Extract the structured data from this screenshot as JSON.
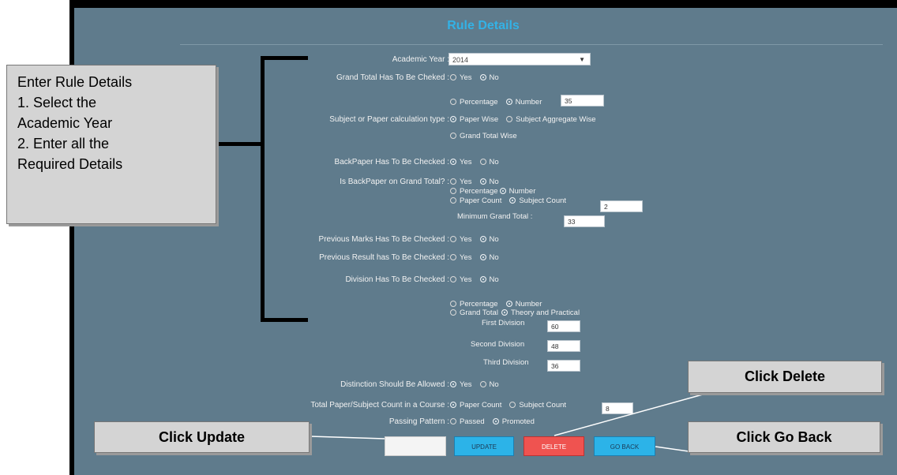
{
  "page": {
    "title": "Rule Details"
  },
  "form": {
    "academic_year": {
      "label": "Academic Year :",
      "value": "2014"
    },
    "grand_total": {
      "label": "Grand Total Has To Be Cheked :",
      "options": [
        "Yes",
        "No"
      ],
      "selected": "No"
    },
    "calc_basis": {
      "options": [
        "Percentage",
        "Number"
      ],
      "selected": "Number",
      "value": "35"
    },
    "calc_type": {
      "label": "Subject or Paper calculation type :",
      "options": [
        "Paper Wise",
        "Subject Aggregate Wise",
        "Grand Total Wise"
      ],
      "selected": "Paper Wise"
    },
    "backpaper": {
      "label": "BackPaper Has To Be Checked :",
      "options": [
        "Yes",
        "No"
      ],
      "selected": "Yes"
    },
    "backpaper_grand": {
      "label": "Is BackPaper on Grand Total? :",
      "options": [
        "Yes",
        "No"
      ],
      "selected": "No",
      "basis_options": [
        "Percentage",
        "Number"
      ],
      "basis_selected": "Number",
      "count_options": [
        "Paper Count",
        "Subject Count"
      ],
      "count_selected": "Subject Count",
      "count_value": "2",
      "min_label": "Minimum Grand Total :",
      "min_value": "33"
    },
    "prev_marks": {
      "label": "Previous Marks Has To Be Checked :",
      "options": [
        "Yes",
        "No"
      ],
      "selected": "No"
    },
    "prev_result": {
      "label": "Previous Result has To Be Checked :",
      "options": [
        "Yes",
        "No"
      ],
      "selected": "No"
    },
    "division": {
      "label": "Division Has To Be Checked :",
      "options": [
        "Yes",
        "No"
      ],
      "selected": "No",
      "basis_options": [
        "Percentage",
        "Number"
      ],
      "basis_selected": "Number",
      "scope_options": [
        "Grand Total",
        "Theory and Practical"
      ],
      "scope_selected": "Theory and Practical",
      "first_label": "First Division",
      "first_value": "60",
      "second_label": "Second Division",
      "second_value": "48",
      "third_label": "Third Division",
      "third_value": "36"
    },
    "distinction": {
      "label": "Distinction Should Be Allowed :",
      "options": [
        "Yes",
        "No"
      ],
      "selected": "Yes"
    },
    "total_count": {
      "label": "Total Paper/Subject Count in a Course :",
      "options": [
        "Paper Count",
        "Subject Count"
      ],
      "selected": "Paper Count",
      "value": "8"
    },
    "passing": {
      "label": "Passing Pattern :",
      "options": [
        "Passed",
        "Promoted"
      ],
      "selected": "Promoted"
    }
  },
  "buttons": {
    "update": "UPDATE",
    "delete": "DELETE",
    "go_back": "GO BACK"
  },
  "callouts": {
    "rule_details": [
      "Enter Rule Details",
      "1. Select the",
      "Academic Year",
      "2. Enter all the",
      "Required Details"
    ],
    "update": "Click Update",
    "delete": "Click Delete",
    "go_back": "Click Go Back"
  },
  "colors": {
    "panel": "#5f7b8c",
    "title": "#33b2e6",
    "update": "#2cb3e8",
    "delete": "#ef5350",
    "go_back": "#2cb3e8",
    "callout": "#d4d4d4"
  }
}
